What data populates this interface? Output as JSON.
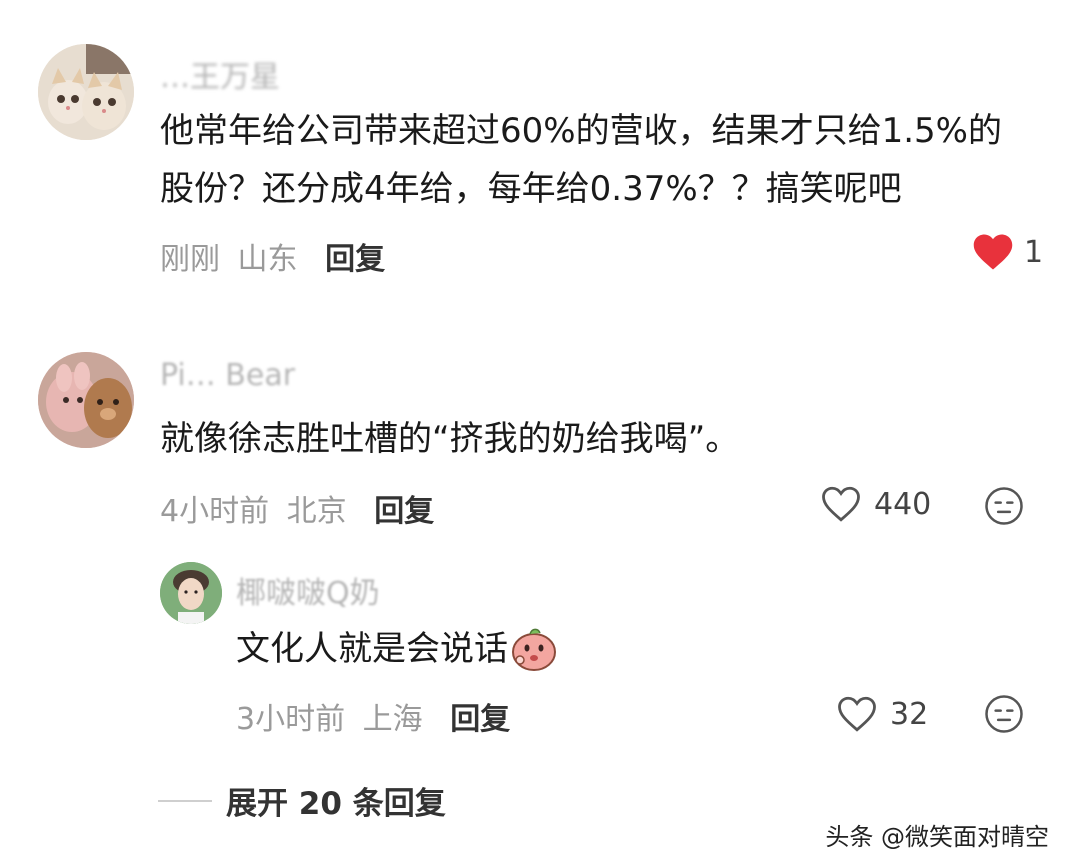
{
  "comments": [
    {
      "username": "…王万星",
      "text_line1": "他常年给公司带来超过60%的营收，结果才只给1.5%的",
      "text_line2": "股份？还分成4年给，每年给0.37%？？搞笑呢吧",
      "time": "刚刚",
      "location": "山东",
      "reply_label": "回复",
      "likes": "1",
      "liked": true
    },
    {
      "username": "Pi… Bear",
      "text": "就像徐志胜吐槽的“挤我的奶给我喝”。",
      "time": "4小时前",
      "location": "北京",
      "reply_label": "回复",
      "likes": "440",
      "liked": false,
      "replies": [
        {
          "username": "椰啵啵Q奶",
          "text": "文化人就是会说话",
          "time": "3小时前",
          "location": "上海",
          "reply_label": "回复",
          "likes": "32",
          "liked": false
        }
      ]
    }
  ],
  "expand_label": "展开 20 条回复",
  "watermark": "头条 @微笑面对晴空",
  "colors": {
    "heart_liked": "#e8323c",
    "meta": "#9a9a9a",
    "username": "#b5b5b5"
  }
}
